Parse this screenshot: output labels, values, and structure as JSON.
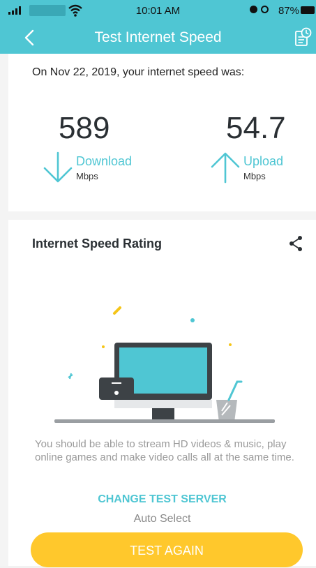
{
  "status_bar": {
    "time": "10:01 AM",
    "battery": "87%"
  },
  "header": {
    "title": "Test Internet Speed",
    "back_icon": "chevron-left-icon",
    "history_icon": "history-report-icon"
  },
  "summary": {
    "date_line": "On Nov 22, 2019, your internet speed was:",
    "download": {
      "value": "589",
      "label": "Download",
      "unit": "Mbps"
    },
    "upload": {
      "value": "54.7",
      "label": "Upload",
      "unit": "Mbps"
    }
  },
  "rating": {
    "heading": "Internet Speed Rating",
    "share_icon": "share-icon",
    "description": "You should be able to stream HD videos & music, play online games and make video calls all at the same time.",
    "change_server_label": "CHANGE TEST SERVER",
    "server_value": "Auto Select",
    "test_again_label": "TEST AGAIN"
  },
  "colors": {
    "accent": "#4fc6d3",
    "button": "#ffc82c",
    "text_dark": "#2a2f33",
    "text_muted": "#9a9a9a"
  }
}
